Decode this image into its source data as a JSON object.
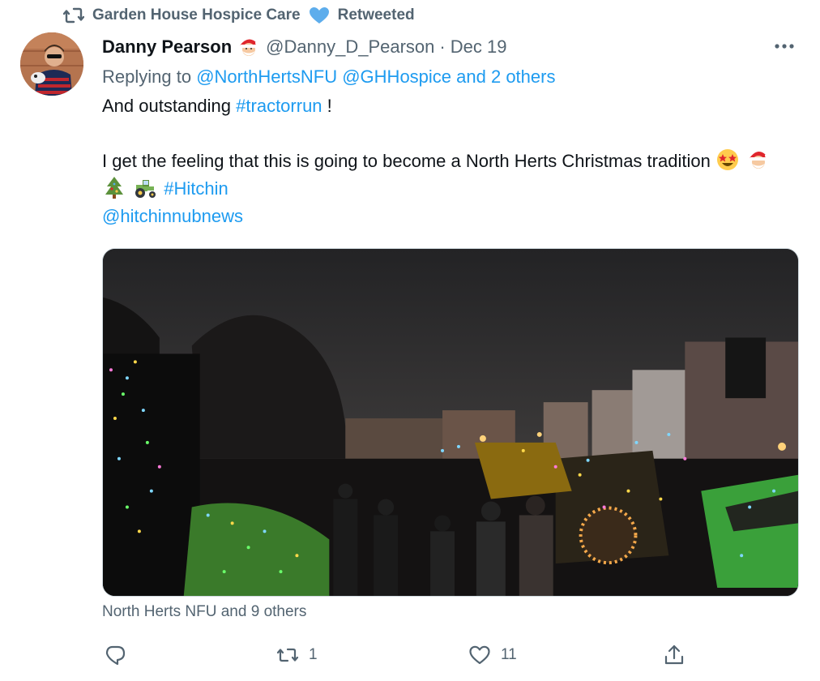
{
  "retweet_banner": {
    "text": "Garden House Hospice Care",
    "suffix": "Retweeted",
    "icon": "retweet-icon",
    "heart_emoji": "blue-heart"
  },
  "tweet": {
    "display_name": "Danny Pearson",
    "name_emoji": "santa",
    "handle": "@Danny_D_Pearson",
    "separator": "·",
    "date": "Dec 19",
    "reply_prefix": "Replying to",
    "reply_targets": "@NorthHertsNFU @GHHospice and 2 others",
    "text_line1_prefix": "And outstanding",
    "text_line1_hashtag": "#tractorrun",
    "text_line1_suffix": "!",
    "text_para2": "I get the feeling that this is going to become a North Herts Christmas tradition",
    "text_para2_emojis": [
      "star-struck",
      "santa",
      "christmas-tree",
      "tractor"
    ],
    "text_hashtag2": "#Hitchin",
    "mention_line": "@hitchinnubnews",
    "liked_by": "North Herts NFU and 9 others",
    "media_icon": "photo-tractor-run"
  },
  "actions": {
    "reply_count": "",
    "retweet_count": "1",
    "like_count": "11",
    "share_count": ""
  },
  "colors": {
    "link": "#1d9bf0",
    "muted": "#536471",
    "text": "#0f1419",
    "border": "#cfd9de"
  }
}
